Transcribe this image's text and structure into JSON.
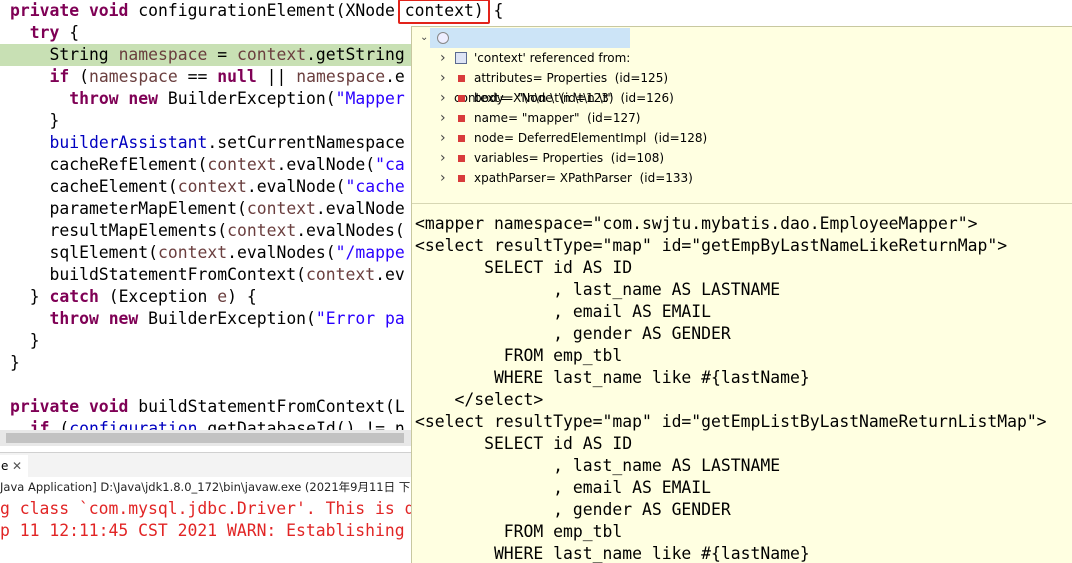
{
  "editor": {
    "lines": [
      [
        {
          "t": "private void ",
          "c": "kw"
        },
        {
          "t": "configurationElement(XNode "
        },
        {
          "t": "context",
          "c": "hl"
        },
        {
          "t": ") {"
        }
      ],
      [
        {
          "t": "  "
        },
        {
          "t": "try",
          "c": "kw"
        },
        {
          "t": " {"
        }
      ],
      [
        {
          "t": "    String "
        },
        {
          "t": "namespace",
          "c": "var"
        },
        {
          "t": " = "
        },
        {
          "t": "context",
          "c": "var"
        },
        {
          "t": ".getString"
        }
      ],
      [
        {
          "t": "    "
        },
        {
          "t": "if",
          "c": "kw"
        },
        {
          "t": " ("
        },
        {
          "t": "namespace",
          "c": "var"
        },
        {
          "t": " == "
        },
        {
          "t": "null",
          "c": "kw"
        },
        {
          "t": " || "
        },
        {
          "t": "namespace",
          "c": "var"
        },
        {
          "t": ".e"
        }
      ],
      [
        {
          "t": "      "
        },
        {
          "t": "throw new",
          "c": "kw"
        },
        {
          "t": " BuilderException("
        },
        {
          "t": "\"Mapper",
          "c": "str"
        }
      ],
      [
        {
          "t": "    }"
        }
      ],
      [
        {
          "t": "    "
        },
        {
          "t": "builderAssistant",
          "c": "fld"
        },
        {
          "t": ".setCurrentNamespace"
        }
      ],
      [
        {
          "t": "    cacheRefElement("
        },
        {
          "t": "context",
          "c": "var"
        },
        {
          "t": ".evalNode("
        },
        {
          "t": "\"ca",
          "c": "str"
        }
      ],
      [
        {
          "t": "    cacheElement("
        },
        {
          "t": "context",
          "c": "var"
        },
        {
          "t": ".evalNode("
        },
        {
          "t": "\"cache",
          "c": "str"
        }
      ],
      [
        {
          "t": "    parameterMapElement("
        },
        {
          "t": "context",
          "c": "var"
        },
        {
          "t": ".evalNode"
        }
      ],
      [
        {
          "t": "    resultMapElements("
        },
        {
          "t": "context",
          "c": "var"
        },
        {
          "t": ".evalNodes("
        }
      ],
      [
        {
          "t": "    sqlElement("
        },
        {
          "t": "context",
          "c": "var"
        },
        {
          "t": ".evalNodes("
        },
        {
          "t": "\"/mappe",
          "c": "str"
        }
      ],
      [
        {
          "t": "    buildStatementFromContext("
        },
        {
          "t": "context",
          "c": "var"
        },
        {
          "t": ".ev"
        }
      ],
      [
        {
          "t": "  } "
        },
        {
          "t": "catch",
          "c": "kw"
        },
        {
          "t": " (Exception "
        },
        {
          "t": "e",
          "c": "var"
        },
        {
          "t": ") {"
        }
      ],
      [
        {
          "t": "    "
        },
        {
          "t": "throw new",
          "c": "kw"
        },
        {
          "t": " BuilderException("
        },
        {
          "t": "\"Error pa",
          "c": "str"
        }
      ],
      [
        {
          "t": "  }"
        }
      ],
      [
        {
          "t": "}"
        }
      ],
      [
        {
          "t": ""
        }
      ],
      [
        {
          "t": "private void ",
          "c": "kw"
        },
        {
          "t": "buildStatementFromContext(L"
        }
      ],
      [
        {
          "t": "  "
        },
        {
          "t": "if",
          "c": "kw"
        },
        {
          "t": " ("
        },
        {
          "t": "configuration",
          "c": "fld"
        },
        {
          "t": ".getDatabaseId() != n"
        }
      ]
    ]
  },
  "console": {
    "tab_label": "e",
    "tab_close": "✕",
    "header": "Java Application] D:\\Java\\jdk1.8.0_172\\bin\\javaw.exe (2021年9月11日 下",
    "lines": [
      "g class `com.mysql.jdbc.Driver'. This is d",
      "p 11 12:11:45 CST 2021 WARN: Establishing"
    ]
  },
  "debug_popup": {
    "root": "context= XNode  (id=123)",
    "children": [
      {
        "label": "'context' referenced from:",
        "icon": "reference-icon"
      },
      {
        "label": "attributes= Properties  (id=125)",
        "icon": "field-icon"
      },
      {
        "label": "body= \"\\n\\n \\t\\n \\t\\n \\t\"  (id=126)",
        "icon": "field-icon"
      },
      {
        "label": "name= \"mapper\"  (id=127)",
        "icon": "field-icon"
      },
      {
        "label": "node= DeferredElementImpl  (id=128)",
        "icon": "field-icon"
      },
      {
        "label": "variables= Properties  (id=108)",
        "icon": "field-icon"
      },
      {
        "label": "xpathParser= XPathParser  (id=133)",
        "icon": "field-icon"
      }
    ],
    "xml_lines": [
      "<mapper namespace=\"com.swjtu.mybatis.dao.EmployeeMapper\">",
      "<select resultType=\"map\" id=\"getEmpByLastNameLikeReturnMap\">",
      "       SELECT id AS ID",
      "              , last_name AS LASTNAME",
      "              , email AS EMAIL",
      "              , gender AS GENDER",
      "         FROM emp_tbl",
      "        WHERE last_name like #{lastName}",
      "    </select>",
      "<select resultType=\"map\" id=\"getEmpListByLastNameReturnListMap\">",
      "       SELECT id AS ID",
      "              , last_name AS LASTNAME",
      "              , email AS EMAIL",
      "              , gender AS GENDER",
      "         FROM emp_tbl",
      "        WHERE last_name like #{lastName}"
    ]
  }
}
